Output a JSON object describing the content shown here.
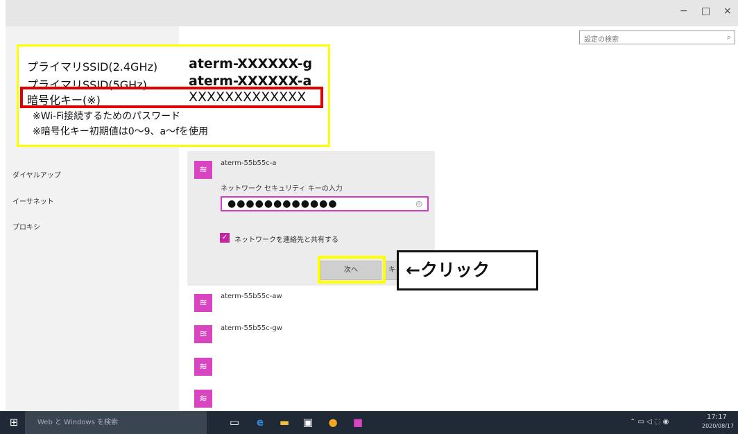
{
  "window": {
    "minimize": "−",
    "maximize": "□",
    "close": "×",
    "search_placeholder": "設定の検索"
  },
  "nav": {
    "items": [
      "ダイヤルアップ",
      "イーサネット",
      "プロキシ"
    ]
  },
  "network": {
    "current_ssid": "aterm-55b55c-a",
    "prompt": "ネットワーク セキュリティ キーの入力",
    "password_mask": "●●●●●●●●●●●●",
    "share_label": "ネットワークを連絡先と共有する",
    "share_checked": true,
    "next_button": "次へ",
    "cancel_button": "キャ",
    "other_ssids": [
      "aterm-55b55c-aw",
      "aterm-55b55c-gw"
    ]
  },
  "annotation": {
    "rows": [
      {
        "label": "プライマリSSID(2.4GHz)",
        "value": "aterm-XXXXXX-g"
      },
      {
        "label": "プライマリSSID(5GHz)",
        "value": "aterm-XXXXXX-a"
      },
      {
        "label": "暗号化キー(※)",
        "value": "XXXXXXXXXXXXX"
      }
    ],
    "note1": "※Wi-Fi接続するためのパスワード",
    "note2": "※暗号化キー初期値は0～9、a～fを使用",
    "click_callout": "←クリック"
  },
  "taskbar": {
    "search_text": "Web と Windows を検索",
    "time": "17:17",
    "date": "2020/08/17"
  },
  "colors": {
    "accent": "#d945c0",
    "highlight_yellow": "#ffff00",
    "highlight_red": "#e10000",
    "taskbar": "#1f2a36"
  }
}
